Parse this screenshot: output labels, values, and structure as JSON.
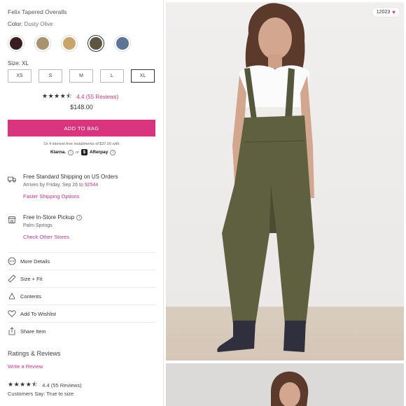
{
  "product": {
    "title": "Felix Tapered Overalls",
    "color_label": "Color:",
    "color_value": "Dusty Olive",
    "swatches": [
      "#3a1f22",
      "#a89370",
      "#c6a46a",
      "#5c5642",
      "#5d7494"
    ],
    "size_label": "Size:",
    "size_value": "XL",
    "sizes": [
      "XS",
      "S",
      "M",
      "L",
      "XL"
    ],
    "selected_size_index": 4,
    "stars": "★★★★⯪",
    "rating_text": "4.4 (55 Reviews)",
    "price": "$148.00",
    "add_to_bag": "ADD TO BAG",
    "installments": "Or 4 interest-free installments of $37.00 with",
    "klarna": "Klarna.",
    "or": "or",
    "afterpay": "Afterpay"
  },
  "shipping": {
    "title": "Free Standard Shipping on US Orders",
    "arrives": "Arrives by Friday, Sep 26 to",
    "zip": "92544",
    "link": "Faster Shipping Options"
  },
  "pickup": {
    "title": "Free In-Store Pickup",
    "store": "Palm Springs",
    "link": "Check Other Stores"
  },
  "menu": {
    "more_details": "More Details",
    "size_fit": "Size + Fit",
    "contents": "Contents",
    "wishlist": "Add To Wishlist",
    "share": "Share Item"
  },
  "reviews": {
    "title": "Ratings & Reviews",
    "write": "Write a Review",
    "stars": "★★★★⯪",
    "rating": "4.4 (55 Reviews)",
    "fit": "Customers Say: True to size"
  },
  "gallery": {
    "likes": "12023"
  },
  "colors": {
    "accent": "#d9357e",
    "link": "#c0378a"
  }
}
